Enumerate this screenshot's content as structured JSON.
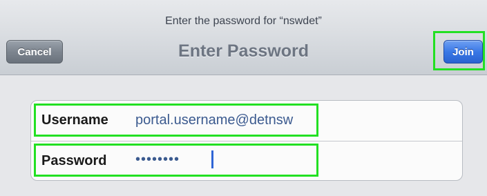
{
  "header": {
    "prompt": "Enter the password for “nswdet”",
    "title": "Enter Password",
    "cancel_label": "Cancel",
    "join_label": "Join"
  },
  "form": {
    "username_label": "Username",
    "username_value": "portal.username@detnsw",
    "password_label": "Password",
    "password_value": "••••••••"
  },
  "colors": {
    "highlight": "#22e022",
    "join_button": "#3a78e6",
    "cancel_button": "#7d858f",
    "field_text": "#3b5a8f"
  }
}
